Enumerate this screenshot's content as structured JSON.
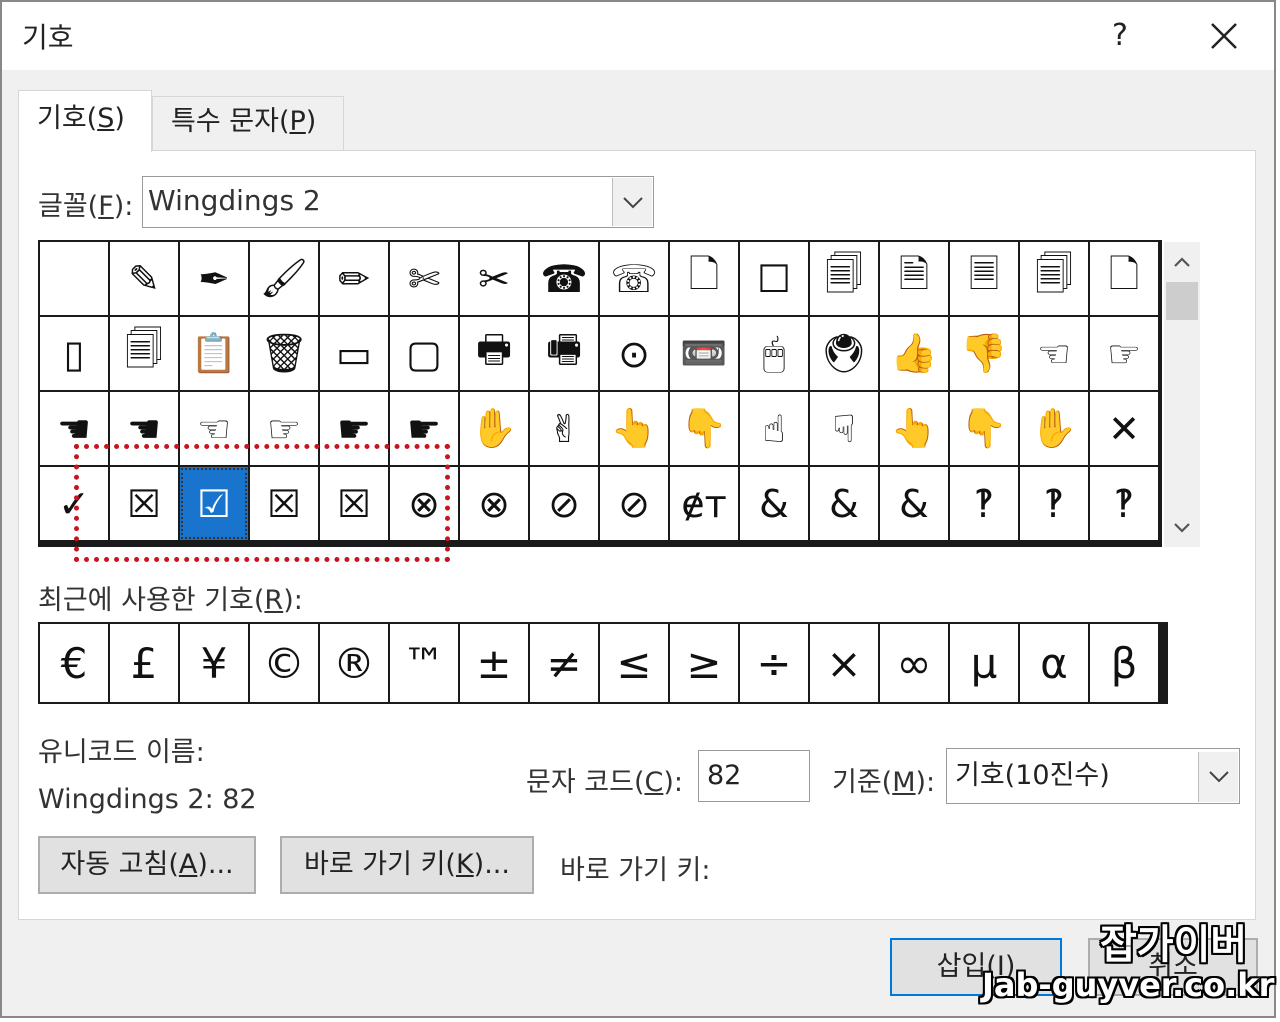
{
  "window": {
    "title": "기호",
    "help": "?"
  },
  "tabs": [
    {
      "label": "기호(",
      "key": "S",
      "tail": ")"
    },
    {
      "label": "특수 문자(",
      "key": "P",
      "tail": ")"
    }
  ],
  "font": {
    "label": "글꼴(",
    "key": "F",
    "tail": "):",
    "value": "Wingdings 2"
  },
  "symbols": [
    [
      "",
      "✎",
      "✒",
      "🖌",
      "✏",
      "✄",
      "✂",
      "☎",
      "☏",
      "🗋",
      "☐",
      "🗐",
      "🗎",
      "🗏",
      "🗐",
      "🗋"
    ],
    [
      "▯",
      "🗐",
      "📋",
      "🗑",
      "▭",
      "▢",
      "🖶",
      "🖷",
      "⊙",
      "📼",
      "🖱",
      "🖲",
      "👍",
      "👎",
      "☜",
      "☞"
    ],
    [
      "☚",
      "☚",
      "☜",
      "☞",
      "☛",
      "☛",
      "✋",
      "✌",
      "👆",
      "👇",
      "☝",
      "☟",
      "👆",
      "👇",
      "✋",
      "✕"
    ],
    [
      "✓",
      "☒",
      "☑",
      "☒",
      "☒",
      "⊗",
      "⊗",
      "⊘",
      "⊘",
      "ɇт",
      "&",
      "&",
      "&",
      "‽",
      "‽",
      "‽"
    ]
  ],
  "selected": {
    "row": 3,
    "col": 2
  },
  "recent": {
    "label": "최근에 사용한 기호(",
    "key": "R",
    "tail": "):",
    "symbols": [
      "€",
      "£",
      "¥",
      "©",
      "®",
      "™",
      "±",
      "≠",
      "≤",
      "≥",
      "÷",
      "×",
      "∞",
      "µ",
      "α",
      "β"
    ]
  },
  "unicode": {
    "label": "유니코드 이름:",
    "value": "Wingdings 2: 82"
  },
  "char_code": {
    "label": "문자 코드(",
    "key": "C",
    "tail": "):",
    "value": "82"
  },
  "base": {
    "label": "기준(",
    "key": "M",
    "tail": "):",
    "value": "기호(10진수)"
  },
  "buttons": {
    "autocorrect": {
      "label": "자동 고침(",
      "key": "A",
      "tail": ")..."
    },
    "shortcut": {
      "label": "바로 가기 키(",
      "key": "K",
      "tail": ")..."
    },
    "insert": {
      "label": "삽입(",
      "key": "I",
      "tail": ")"
    },
    "cancel": "취소"
  },
  "shortcut_label": "바로 가기 키:",
  "watermark": {
    "line1": "잡가이버",
    "line2": "Jab-guyver.co.kr"
  },
  "colors": {
    "selection": "#1874cd",
    "highlight_box": "#c8141e",
    "dialog_bg": "#f0f0f0"
  }
}
